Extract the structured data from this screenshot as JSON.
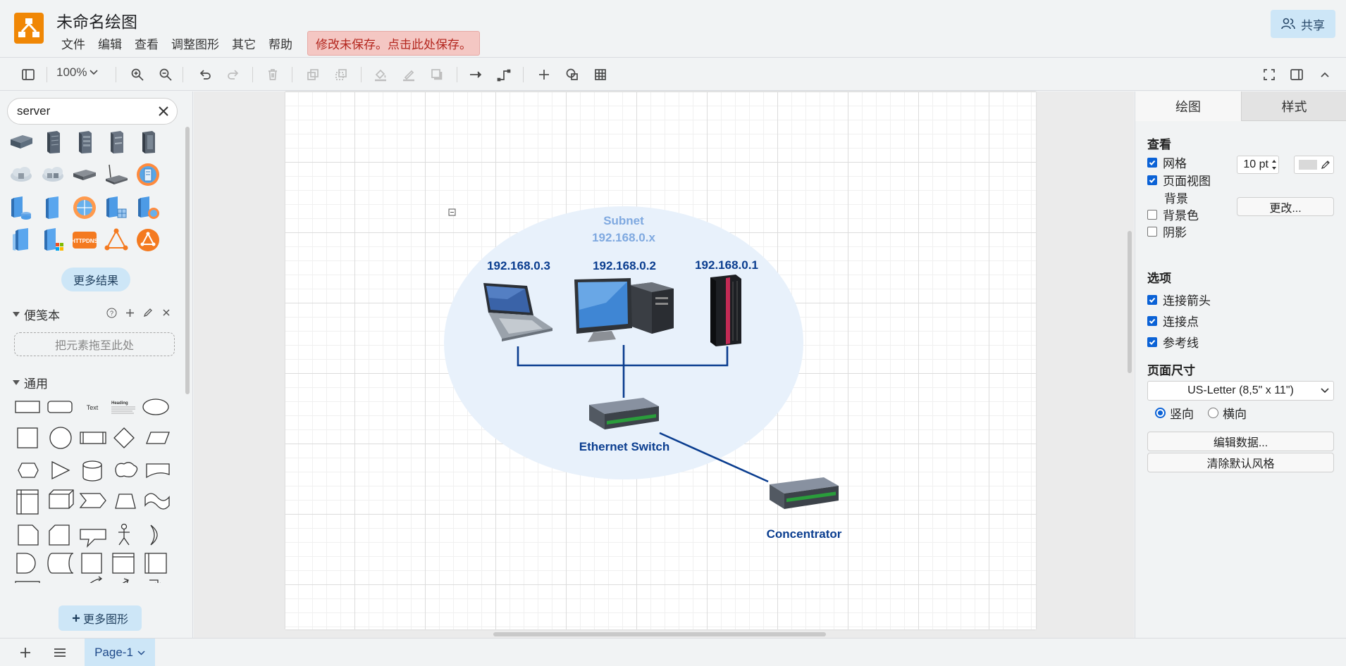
{
  "app": {
    "title": "未命名绘图",
    "menu": [
      "文件",
      "编辑",
      "查看",
      "调整图形",
      "其它",
      "帮助"
    ],
    "unsaved_notice": "修改未保存。点击此处保存。",
    "share_label": "共享"
  },
  "toolbar": {
    "zoom": "100%"
  },
  "left_panel": {
    "search_value": "server",
    "more_results": "更多结果",
    "scratchpad_title": "便笺本",
    "drop_hint": "把元素拖至此处",
    "general_title": "通用",
    "more_shapes": "更多图形",
    "shape_text_label": "Text",
    "shape_heading_label": "Heading"
  },
  "diagram": {
    "subnet_title": "Subnet",
    "subnet_range": "192.168.0.x",
    "laptop_ip": "192.168.0.3",
    "desktop_ip": "192.168.0.2",
    "server_ip": "192.168.0.1",
    "switch_label": "Ethernet Switch",
    "concentrator_label": "Concentrator",
    "line_color": "#0a3d8f",
    "subnet_fill": "#e8f1fb"
  },
  "right_panel": {
    "tab_diagram": "绘图",
    "tab_style": "样式",
    "view_section": "查看",
    "grid_label": "网格",
    "grid_size": "10 pt",
    "page_view_label": "页面视图",
    "background_label": "背景",
    "change_button": "更改...",
    "bg_color_label": "背景色",
    "shadow_label": "阴影",
    "options_section": "选项",
    "connection_arrows": "连接箭头",
    "connection_points": "连接点",
    "guides": "参考线",
    "page_size_section": "页面尺寸",
    "page_size_value": "US-Letter (8,5\" x 11\")",
    "portrait": "竖向",
    "landscape": "横向",
    "edit_data": "编辑数据...",
    "clear_style": "清除默认风格"
  },
  "footer": {
    "page_tab": "Page-1"
  }
}
